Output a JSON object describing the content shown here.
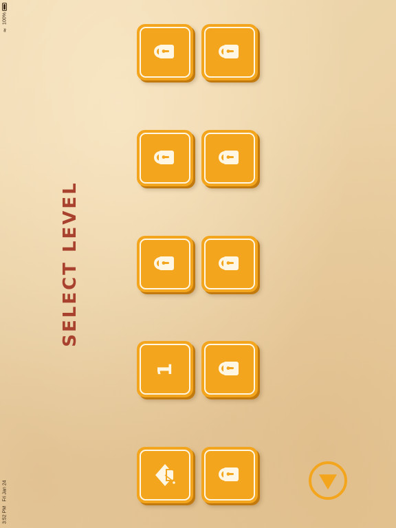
{
  "status_bar": {
    "time": "3:52 PM",
    "date": "Fri Jan 24",
    "battery": "100%",
    "wifi_icon": "wifi-icon",
    "battery_icon": "battery-icon"
  },
  "title": "SELECT LEVEL",
  "colors": {
    "tile": "#f3a61d",
    "tile_shadow": "#c27a0e",
    "tile_border": "#fff6e4",
    "title": "#a8422f",
    "background": "#ecd3a8"
  },
  "levels": [
    {
      "row": 1,
      "col": 1,
      "state": "locked",
      "icon": "lock-icon"
    },
    {
      "row": 1,
      "col": 2,
      "state": "locked",
      "icon": "lock-icon"
    },
    {
      "row": 2,
      "col": 1,
      "state": "locked",
      "icon": "lock-icon"
    },
    {
      "row": 2,
      "col": 2,
      "state": "locked",
      "icon": "lock-icon"
    },
    {
      "row": 3,
      "col": 1,
      "state": "locked",
      "icon": "lock-icon"
    },
    {
      "row": 3,
      "col": 2,
      "state": "locked",
      "icon": "lock-icon"
    },
    {
      "row": 4,
      "col": 1,
      "state": "unlocked",
      "label": "1"
    },
    {
      "row": 4,
      "col": 2,
      "state": "locked",
      "icon": "lock-icon"
    },
    {
      "row": 5,
      "col": 1,
      "state": "special",
      "icon": "graduation-cap-icon"
    },
    {
      "row": 5,
      "col": 2,
      "state": "locked",
      "icon": "lock-icon"
    }
  ],
  "next_button": {
    "icon": "triangle-down-icon"
  }
}
